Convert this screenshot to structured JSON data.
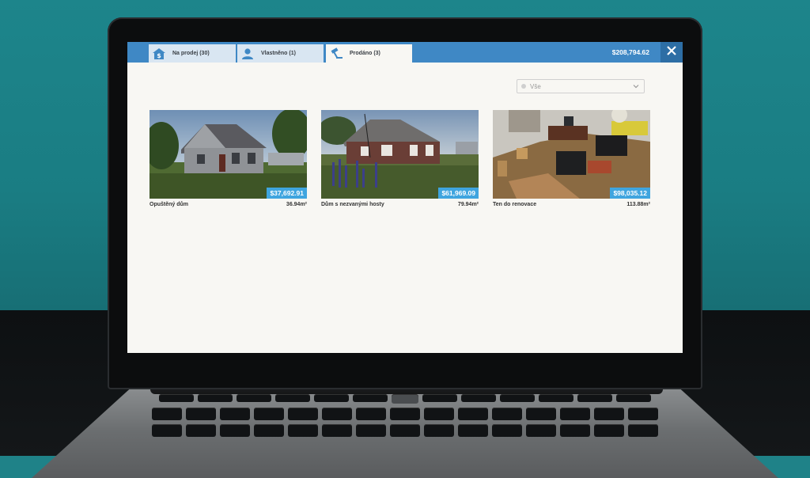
{
  "tabs": [
    {
      "label": "Na prodej (30)",
      "icon": "house-dollar-icon",
      "active": false
    },
    {
      "label": "Vlastněno (1)",
      "icon": "person-icon",
      "active": false
    },
    {
      "label": "Prodáno (3)",
      "icon": "gavel-icon",
      "active": true
    }
  ],
  "header": {
    "balance": "$208,794.62",
    "close_icon": "close-icon"
  },
  "filter": {
    "selected": "Vše"
  },
  "properties": [
    {
      "name": "Opuštěný dům",
      "price": "$37,692.91",
      "area": "36.94m²"
    },
    {
      "name": "Dům s nezvanými hosty",
      "price": "$61,969.09",
      "area": "79.94m²"
    },
    {
      "name": "Ten do renovace",
      "price": "$98,035.12",
      "area": "113.88m²"
    }
  ],
  "colors": {
    "accent": "#3f88c5",
    "price_badge": "#3fa5df",
    "wall": "#1d858b"
  }
}
